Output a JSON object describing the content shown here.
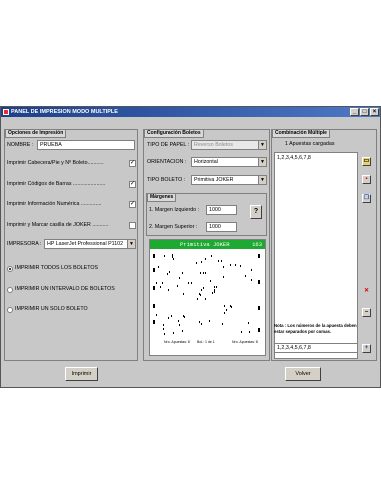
{
  "window": {
    "title": "PANEL DE IMPRESION MODO MULTIPLE"
  },
  "opciones": {
    "title": "Opciones de Impresión",
    "nombre_label": "NOMBRE :",
    "nombre_value": "PRUEBA",
    "checks": [
      {
        "label": "Imprimir Cabecera/Pie y Nº Boleto...........",
        "mark": "✓"
      },
      {
        "label": "Imprimir Códigos de Barras ......................",
        "mark": "✓"
      },
      {
        "label": "Imprimir Información Numérica ..............",
        "mark": "✓"
      },
      {
        "label": "Imprimir y Marcar casilla de JOKER ...........",
        "mark": ""
      }
    ],
    "impresora_label": "IMPRESORA :",
    "impresora_value": "HP LaserJet Professional P1102",
    "radios": [
      {
        "label": "IMPRIMIR TODOS LOS BOLETOS",
        "selected": true
      },
      {
        "label": "IMPRIMIR UN INTERVALO DE BOLETOS",
        "selected": false
      },
      {
        "label": "IMPRIMIR UN SOLO BOLETO",
        "selected": false
      }
    ]
  },
  "config": {
    "title": "Configuración Boletos",
    "tipo_papel_label": "TIPO DE PAPEL :",
    "tipo_papel_value": "Reverso Boletos",
    "orientacion_label": "ORIENTACION :",
    "orientacion_value": "Horizontal",
    "tipo_boleto_label": "TIPO BOLETO :",
    "tipo_boleto_value": "Primitiva JOKER",
    "margenes_title": "Márgenes",
    "margen_izq_label": "1. Margen Izquierdo :",
    "margen_izq_value": "1000",
    "margen_sup_label": "2. Margen Superior :",
    "margen_sup_value": "1000",
    "help_label": "?",
    "ticket_name": "Primitiva JOKER",
    "ticket_code": "163",
    "ticket_footer": [
      "Nro. Apuestas: 8",
      "Bol.: 1 de 1",
      "Nro. Apuestas: 8"
    ]
  },
  "combinacion": {
    "title": "Combinación Múltiple",
    "count_label": "1 Apuestas cargadas",
    "items": [
      "1,2,3,4,5,6,7,8"
    ],
    "note": "Nota : Los números de la apuesta deben estar separados por comas.",
    "input_value": "1,2,3,4,5,6,7,8",
    "icons": [
      "folder-icon",
      "save-icon",
      "copy-icon",
      "delete-icon",
      "remove-icon",
      "add-icon"
    ]
  },
  "buttons": {
    "imprimir": "Imprimir",
    "volver": "Volver"
  }
}
